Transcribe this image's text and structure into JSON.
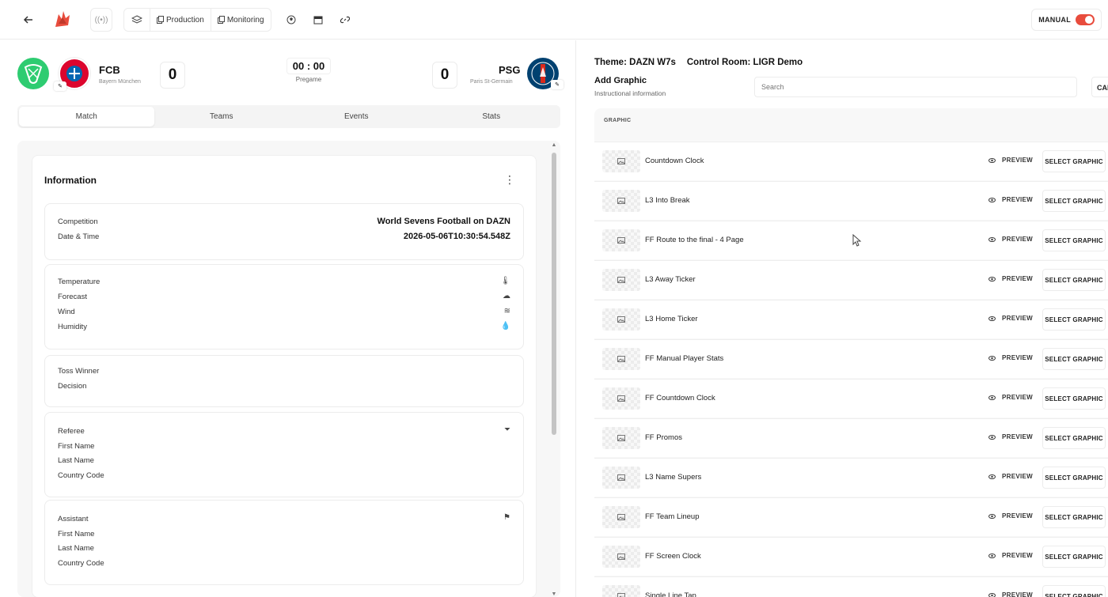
{
  "topbar": {
    "production_label": "Production",
    "monitoring_label": "Monitoring",
    "mode_label": "MANUAL"
  },
  "match": {
    "home": {
      "abbr": "FCB",
      "name": "Bayern München",
      "score": "0"
    },
    "away": {
      "abbr": "PSG",
      "name": "Paris St-Germain",
      "score": "0"
    },
    "clock": {
      "minutes": "00",
      "seconds": "00",
      "state": "Pregame"
    }
  },
  "tabs": [
    {
      "label": "Match"
    },
    {
      "label": "Teams"
    },
    {
      "label": "Events"
    },
    {
      "label": "Stats"
    }
  ],
  "information": {
    "title": "Information",
    "competition_label": "Competition",
    "competition_value": "World Sevens Football on DAZN",
    "datetime_label": "Date & Time",
    "datetime_value": "2026-05-06T10:30:54.548Z",
    "weather": [
      "Temperature",
      "Forecast",
      "Wind",
      "Humidity"
    ],
    "toss": [
      "Toss Winner",
      "Decision"
    ],
    "referee": [
      "Referee",
      "First Name",
      "Last Name",
      "Country Code"
    ],
    "assistant": [
      "Assistant",
      "First Name",
      "Last Name",
      "Country Code"
    ]
  },
  "right": {
    "theme_label": "Theme: DAZN W7s",
    "control_room_label": "Control Room: LIGR Demo",
    "add_graphic": "Add Graphic",
    "instructional": "Instructional information",
    "search_placeholder": "Search",
    "cancel_label": "CAN",
    "list_header": "GRAPHIC",
    "preview_label": "PREVIEW",
    "select_label": "SELECT GRAPHIC",
    "graphics": [
      "Countdown Clock",
      "L3 Into Break",
      "FF Route to the final - 4 Page",
      "L3 Away Ticker",
      "L3 Home Ticker",
      "FF Manual Player Stats",
      "FF Countdown Clock",
      "FF Promos",
      "L3 Name Supers",
      "FF Team Lineup",
      "FF Screen Clock",
      "Single Line Tap"
    ]
  },
  "colors": {
    "accent": "#e84c3d",
    "home_logo": "#dc052d",
    "away_logo": "#004170",
    "league_logo": "#2ecc71"
  }
}
